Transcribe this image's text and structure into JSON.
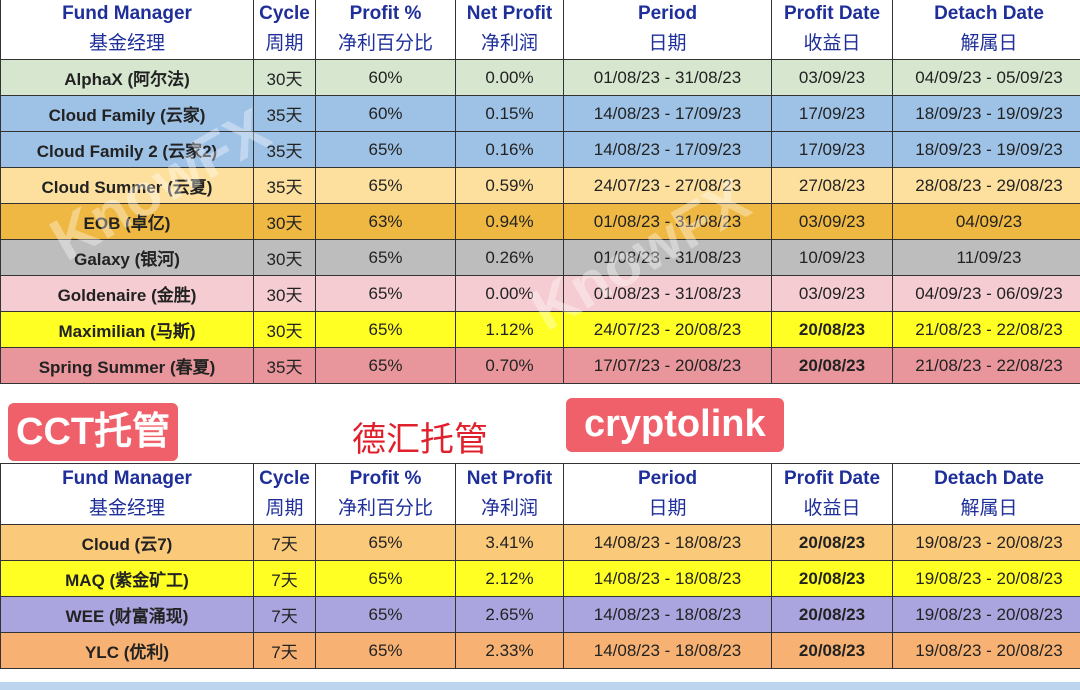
{
  "headers": [
    {
      "en": "Fund Manager",
      "cn": "基金经理"
    },
    {
      "en": "Cycle",
      "cn": "周期"
    },
    {
      "en": "Profit %",
      "cn": "净利百分比"
    },
    {
      "en": "Net Profit",
      "cn": "净利润"
    },
    {
      "en": "Period",
      "cn": "日期"
    },
    {
      "en": "Profit Date",
      "cn": "收益日"
    },
    {
      "en": "Detach Date",
      "cn": "解属日"
    }
  ],
  "table1": [
    {
      "name": "AlphaX (阿尔法)",
      "cycle": "30天",
      "profit": "60%",
      "net": "0.00%",
      "period": "01/08/23 - 31/08/23",
      "pdate": "03/09/23",
      "ddate": "04/09/23 - 05/09/23",
      "color": "#d6e6cf",
      "bold": false
    },
    {
      "name": "Cloud Family (云家)",
      "cycle": "35天",
      "profit": "60%",
      "net": "0.15%",
      "period": "14/08/23 - 17/09/23",
      "pdate": "17/09/23",
      "ddate": "18/09/23 - 19/09/23",
      "color": "#9ec2e6",
      "bold": false
    },
    {
      "name": "Cloud Family 2 (云家2)",
      "cycle": "35天",
      "profit": "65%",
      "net": "0.16%",
      "period": "14/08/23 - 17/09/23",
      "pdate": "17/09/23",
      "ddate": "18/09/23 - 19/09/23",
      "color": "#9ec2e6",
      "bold": false
    },
    {
      "name": "Cloud Summer (云夏)",
      "cycle": "35天",
      "profit": "65%",
      "net": "0.59%",
      "period": "24/07/23 - 27/08/23",
      "pdate": "27/08/23",
      "ddate": "28/08/23 - 29/08/23",
      "color": "#fde09e",
      "bold": false
    },
    {
      "name": "EOB (卓亿)",
      "cycle": "30天",
      "profit": "63%",
      "net": "0.94%",
      "period": "01/08/23 - 31/08/23",
      "pdate": "03/09/23",
      "ddate": "04/09/23",
      "color": "#efb842",
      "bold": false
    },
    {
      "name": "Galaxy (银河)",
      "cycle": "30天",
      "profit": "65%",
      "net": "0.26%",
      "period": "01/08/23 - 31/08/23",
      "pdate": "10/09/23",
      "ddate": "11/09/23",
      "color": "#bdbdbd",
      "bold": false
    },
    {
      "name": "Goldenaire (金胜)",
      "cycle": "30天",
      "profit": "65%",
      "net": "0.00%",
      "period": "01/08/23 - 31/08/23",
      "pdate": "03/09/23",
      "ddate": "04/09/23 - 06/09/23",
      "color": "#f4ccd2",
      "bold": false
    },
    {
      "name": "Maximilian (马斯)",
      "cycle": "30天",
      "profit": "65%",
      "net": "1.12%",
      "period": "24/07/23 - 20/08/23",
      "pdate": "20/08/23",
      "ddate": "21/08/23 - 22/08/23",
      "color": "#ffff24",
      "bold": true
    },
    {
      "name": "Spring Summer (春夏)",
      "cycle": "35天",
      "profit": "65%",
      "net": "0.70%",
      "period": "17/07/23 - 20/08/23",
      "pdate": "20/08/23",
      "ddate": "21/08/23 - 22/08/23",
      "color": "#e8969b",
      "bold": true
    }
  ],
  "labels": {
    "cct": "CCT托管",
    "dehui": "德汇托管",
    "cryptolink": "cryptolink",
    "watermark": "KnowFX"
  },
  "table2": [
    {
      "name": "Cloud (云7)",
      "cycle": "7天",
      "profit": "65%",
      "net": "3.41%",
      "period": "14/08/23 - 18/08/23",
      "pdate": "20/08/23",
      "ddate": "19/08/23 - 20/08/23",
      "color": "#fbc97a",
      "bold": true
    },
    {
      "name": "MAQ (紫金矿工)",
      "cycle": "7天",
      "profit": "65%",
      "net": "2.12%",
      "period": "14/08/23 - 18/08/23",
      "pdate": "20/08/23",
      "ddate": "19/08/23 - 20/08/23",
      "color": "#ffff24",
      "bold": true
    },
    {
      "name": "WEE (财富涌现)",
      "cycle": "7天",
      "profit": "65%",
      "net": "2.65%",
      "period": "14/08/23 - 18/08/23",
      "pdate": "20/08/23",
      "ddate": "19/08/23 - 20/08/23",
      "color": "#aaa5de",
      "bold": true
    },
    {
      "name": "YLC (优利)",
      "cycle": "7天",
      "profit": "65%",
      "net": "2.33%",
      "period": "14/08/23 - 18/08/23",
      "pdate": "20/08/23",
      "ddate": "19/08/23 - 20/08/23",
      "color": "#f7b273",
      "bold": true
    }
  ]
}
